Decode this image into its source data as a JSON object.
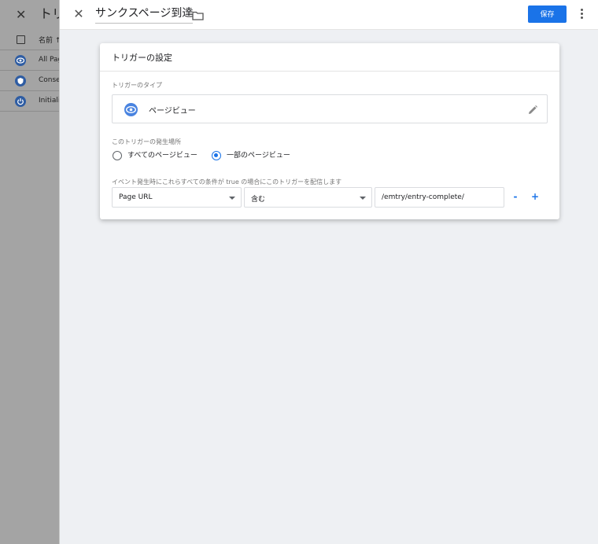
{
  "background_list": {
    "title": "トリ",
    "column_name": "名前 ↑",
    "rows": [
      {
        "label": "All Pag",
        "icon": "eye-icon"
      },
      {
        "label": "Conse",
        "icon": "shield-icon"
      },
      {
        "label": "Initiali",
        "icon": "power-icon"
      }
    ]
  },
  "panel": {
    "title": "サンクスページ到達",
    "save_label": "保存"
  },
  "card": {
    "title": "トリガーの設定",
    "trigger_type_label": "トリガーのタイプ",
    "trigger_type_value": "ページビュー",
    "fires_on_label": "このトリガーの発生場所",
    "radio_all": "すべてのページビュー",
    "radio_some": "一部のページビュー",
    "selected_radio": "some",
    "condition_label": "イベント発生時にこれらすべての条件が true の場合にこのトリガーを配信します",
    "condition": {
      "variable": "Page URL",
      "operator": "含む",
      "value": "/emtry/entry-complete/"
    },
    "remove_label": "-",
    "add_label": "+"
  },
  "colors": {
    "primary": "#1a73e8",
    "trigger_icon": "#4a84e0",
    "background_dim": "#a4a4a4",
    "panel_bg": "#eef0f3"
  }
}
